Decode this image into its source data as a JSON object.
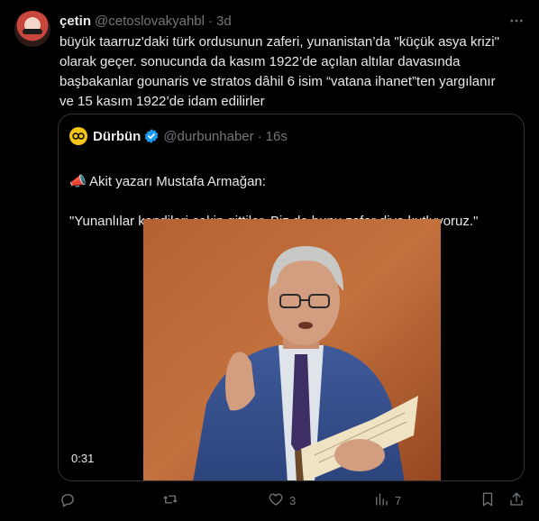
{
  "tweet": {
    "author_name": "çetin",
    "author_handle": "@cetoslovakyahbl",
    "separator": "·",
    "time": "3d",
    "text": "büyük taarruz'daki türk ordusunun zaferi, yunanistan’da \"küçük asya krizi\"\nolarak geçer. sonucunda da kasım 1922’de açılan altılar davasında\nbaşbakanlar gounaris ve stratos dâhil 6 isim “vatana ihanet”ten yargılanır\nve 15 kasım 1922’de idam edilirler"
  },
  "quote": {
    "author_name": "Dürbün",
    "author_handle": "@durbunhaber",
    "separator": "·",
    "time": "16s",
    "line1": "📣 Akit yazarı Mustafa Armağan:",
    "line2": "\"Yunanlılar kendileri çekip gittiler. Biz de bunu zafer diye kutluyoruz.\"",
    "video_duration": "0:31"
  },
  "actions": {
    "reply_count": "",
    "retweet_count": "",
    "like_count": "3",
    "views_count": "7"
  },
  "icons": {
    "more": "more-icon",
    "verified": "verified-badge-icon",
    "reply": "reply-icon",
    "retweet": "retweet-icon",
    "like": "heart-icon",
    "views": "views-icon",
    "bookmark": "bookmark-icon",
    "share": "share-icon"
  },
  "colors": {
    "background": "#000000",
    "text": "#e7e9ea",
    "muted": "#71767b",
    "border": "#2f3336",
    "verified": "#1d9bf0"
  }
}
